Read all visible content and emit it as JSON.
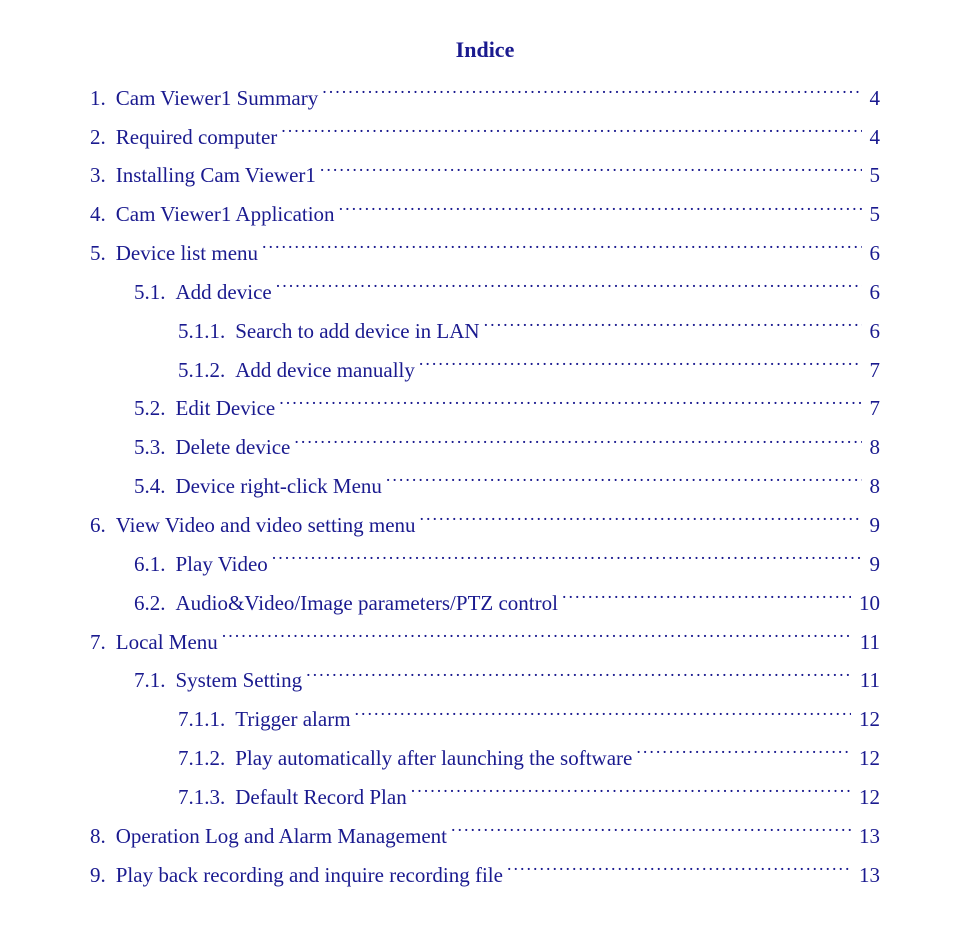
{
  "title": "Indice",
  "toc": [
    {
      "level": 1,
      "num": "1.",
      "label": "Cam Viewer1 Summary",
      "page": "4"
    },
    {
      "level": 1,
      "num": "2.",
      "label": "Required computer",
      "page": "4"
    },
    {
      "level": 1,
      "num": "3.",
      "label": "Installing Cam Viewer1",
      "page": "5"
    },
    {
      "level": 1,
      "num": "4.",
      "label": "Cam Viewer1 Application",
      "page": "5"
    },
    {
      "level": 1,
      "num": "5.",
      "label": "Device list menu",
      "page": "6"
    },
    {
      "level": 2,
      "num": "5.1.",
      "label": "Add device",
      "page": "6"
    },
    {
      "level": 3,
      "num": "5.1.1.",
      "label": "Search to add device in LAN",
      "page": "6"
    },
    {
      "level": 3,
      "num": "5.1.2.",
      "label": "Add device manually",
      "page": "7"
    },
    {
      "level": 2,
      "num": "5.2.",
      "label": "Edit Device",
      "page": "7"
    },
    {
      "level": 2,
      "num": "5.3.",
      "label": "Delete device",
      "page": "8"
    },
    {
      "level": 2,
      "num": "5.4.",
      "label": "Device right-click Menu",
      "page": "8"
    },
    {
      "level": 1,
      "num": "6.",
      "label": "View Video and video setting menu",
      "page": "9"
    },
    {
      "level": 2,
      "num": "6.1.",
      "label": "Play Video",
      "page": "9"
    },
    {
      "level": 2,
      "num": "6.2.",
      "label": "Audio&Video/Image parameters/PTZ control",
      "page": "10"
    },
    {
      "level": 1,
      "num": "7.",
      "label": "Local Menu",
      "page": "11"
    },
    {
      "level": 2,
      "num": "7.1.",
      "label": "System Setting",
      "page": "11"
    },
    {
      "level": 3,
      "num": "7.1.1.",
      "label": "Trigger alarm",
      "page": "12"
    },
    {
      "level": 3,
      "num": "7.1.2.",
      "label": "Play automatically after launching the software",
      "page": "12"
    },
    {
      "level": 3,
      "num": "7.1.3.",
      "label": "Default Record Plan",
      "page": "12"
    },
    {
      "level": 1,
      "num": "8.",
      "label": "Operation Log and Alarm Management",
      "page": "13"
    },
    {
      "level": 1,
      "num": "9.",
      "label": "Play back recording and inquire recording file",
      "page": "13"
    }
  ]
}
